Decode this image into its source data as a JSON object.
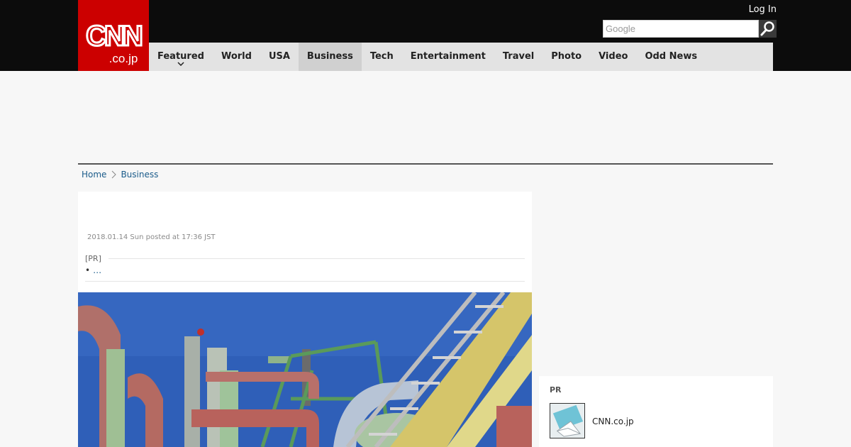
{
  "header": {
    "logo_text": "CNN.co.jp",
    "login_label": "Log In",
    "search_placeholder": "Google",
    "nav": [
      {
        "label": "Featured"
      },
      {
        "label": "World"
      },
      {
        "label": "USA"
      },
      {
        "label": "Business"
      },
      {
        "label": "Tech"
      },
      {
        "label": "Entertainment"
      },
      {
        "label": "Travel"
      },
      {
        "label": "Photo"
      },
      {
        "label": "Video"
      },
      {
        "label": "Odd News"
      }
    ],
    "active_nav": "Business"
  },
  "breadcrumb": {
    "home": "Home",
    "current": "Business"
  },
  "article": {
    "posted": "2018.01.14 Sun posted at 17:36 JST",
    "pr_label": "[PR]",
    "pr_link": "…"
  },
  "sidebar": {
    "pr_label": "PR",
    "link_text": "CNN.co.jp"
  },
  "colors": {
    "brand_red": "#cc0000",
    "header_bg": "#0c0c0c",
    "nav_bg": "#e3e3e3",
    "link": "#1a5b8a"
  },
  "icons": [
    "search-icon",
    "chevron-down-icon",
    "chevron-right-icon"
  ]
}
